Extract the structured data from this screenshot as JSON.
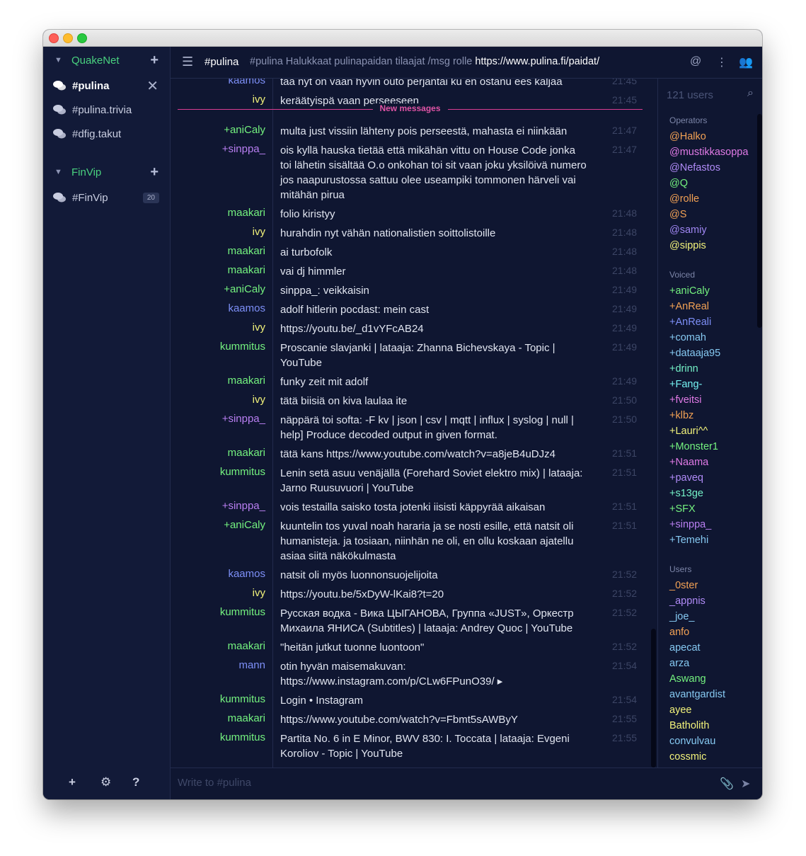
{
  "sidebar": {
    "networks": [
      {
        "name": "QuakeNet",
        "channels": [
          {
            "label": "#pulina",
            "active": true
          },
          {
            "label": "#pulina.trivia"
          },
          {
            "label": "#dfig.takut"
          }
        ]
      },
      {
        "name": "FinVip",
        "channels": [
          {
            "label": "#FinVip",
            "badge": "20"
          }
        ]
      }
    ]
  },
  "header": {
    "channel": "#pulina",
    "topic_text": "#pulina Halukkaat pulinapaidan tilaajat /msg rolle",
    "topic_link": "https://www.pulina.fi/paidat/"
  },
  "new_messages_label": "New messages",
  "messages": [
    {
      "nick": "kaamos",
      "color": "#7d8ff7",
      "time": "21:45",
      "lines": [
        "taa nyt on vaan hyvin outo perjantai ku en ostanu ees kaljaa"
      ]
    },
    {
      "nick": "ivy",
      "color": "#f2f27a",
      "time": "21:45",
      "lines": [
        "keräätyispä vaan perseeseen"
      ]
    },
    {
      "nick": "+aniCaly",
      "color": "#74f27f",
      "time": "21:47",
      "lines": [
        "multa just vissiin lähteny pois perseestä, mahasta ei niinkään"
      ]
    },
    {
      "nick": "+sinppa_",
      "color": "#b97ff2",
      "time": "21:47",
      "lines": [
        "ois kyllä hauska tietää että mikähän vittu on House Code jonka",
        "toi lähetin sisältää O.o onkohan toi sit vaan joku yksilöivä numero",
        "jos naapurustossa sattuu olee useampiki tommonen härveli vai",
        "mitähän pirua"
      ]
    },
    {
      "nick": "maakari",
      "color": "#74f27f",
      "time": "21:48",
      "lines": [
        "folio kiristyy"
      ]
    },
    {
      "nick": "ivy",
      "color": "#f2f27a",
      "time": "21:48",
      "lines": [
        "hurahdin nyt vähän nationalistien soittolistoille"
      ]
    },
    {
      "nick": "maakari",
      "color": "#74f27f",
      "time": "21:48",
      "lines": [
        "ai turbofolk"
      ]
    },
    {
      "nick": "maakari",
      "color": "#74f27f",
      "time": "21:48",
      "lines": [
        "vai dj himmler"
      ]
    },
    {
      "nick": "+aniCaly",
      "color": "#74f27f",
      "time": "21:49",
      "lines": [
        "sinppa_: veikkaisin"
      ]
    },
    {
      "nick": "kaamos",
      "color": "#7d8ff7",
      "time": "21:49",
      "lines": [
        "adolf hitlerin pocdast: mein cast"
      ]
    },
    {
      "nick": "ivy",
      "color": "#f2f27a",
      "time": "21:49",
      "lines": [
        "https://youtu.be/_d1vYFcAB24"
      ]
    },
    {
      "nick": "kummitus",
      "color": "#74f27f",
      "time": "21:49",
      "lines": [
        "Proscanie slavjanki | lataaja: Zhanna Bichevskaya - Topic |",
        "YouTube"
      ]
    },
    {
      "nick": "maakari",
      "color": "#74f27f",
      "time": "21:49",
      "lines": [
        "funky zeit mit adolf"
      ]
    },
    {
      "nick": "ivy",
      "color": "#f2f27a",
      "time": "21:50",
      "lines": [
        "tätä biisiä on kiva laulaa ite"
      ]
    },
    {
      "nick": "+sinppa_",
      "color": "#b97ff2",
      "time": "21:50",
      "lines": [
        "näppärä toi softa: -F kv | json | csv | mqtt | influx | syslog | null |",
        "help] Produce decoded output in given format."
      ]
    },
    {
      "nick": "maakari",
      "color": "#74f27f",
      "time": "21:51",
      "lines": [
        "tätä kans https://www.youtube.com/watch?v=a8jeB4uDJz4"
      ]
    },
    {
      "nick": "kummitus",
      "color": "#74f27f",
      "time": "21:51",
      "lines": [
        "Lenin setä asuu venäjällä (Forehard Soviet elektro mix) | lataaja:",
        "Jarno Ruusuvuori | YouTube"
      ]
    },
    {
      "nick": "+sinppa_",
      "color": "#b97ff2",
      "time": "21:51",
      "lines": [
        "vois testailla saisko tosta jotenki iisisti käppyrää aikaisan"
      ]
    },
    {
      "nick": "+aniCaly",
      "color": "#74f27f",
      "time": "21:51",
      "lines": [
        "kuuntelin tos yuval noah hararia ja se nosti esille, että natsit oli",
        "humanisteja. ja tosiaan, niinhän ne oli, en ollu koskaan ajatellu",
        "asiaa siitä näkökulmasta"
      ]
    },
    {
      "nick": "kaamos",
      "color": "#7d8ff7",
      "time": "21:52",
      "lines": [
        "natsit oli myös luonnonsuojelijoita"
      ]
    },
    {
      "nick": "ivy",
      "color": "#f2f27a",
      "time": "21:52",
      "lines": [
        "https://youtu.be/5xDyW-lKai8?t=20"
      ]
    },
    {
      "nick": "kummitus",
      "color": "#74f27f",
      "time": "21:52",
      "lines": [
        "Русская водка - Вика ЦЫГАНОВА, Группа «JUST», Оркестр",
        "Михаила ЯНИСА (Subtitles) | lataaja: Andrey Quoc | YouTube"
      ]
    },
    {
      "nick": "maakari",
      "color": "#74f27f",
      "time": "21:52",
      "lines": [
        "\"heitän jutkut tuonne luontoon\""
      ]
    },
    {
      "nick": "mann",
      "color": "#7d8ff7",
      "time": "21:54",
      "lines": [
        "otin hyvän maisemakuvan:",
        "https://www.instagram.com/p/CLw6FPunO39/ ▸"
      ]
    },
    {
      "nick": "kummitus",
      "color": "#74f27f",
      "time": "21:54",
      "lines": [
        "Login • Instagram"
      ]
    },
    {
      "nick": "maakari",
      "color": "#74f27f",
      "time": "21:55",
      "lines": [
        "https://www.youtube.com/watch?v=Fbmt5sAWByY"
      ]
    },
    {
      "nick": "kummitus",
      "color": "#74f27f",
      "time": "21:55",
      "lines": [
        "Partita No. 6 in E Minor, BWV 830: I. Toccata | lataaja: Evgeni",
        "Koroliov - Topic | YouTube"
      ]
    }
  ],
  "userlist": {
    "count": "121 users",
    "sections": [
      {
        "title": "Operators",
        "users": [
          {
            "name": "@Halko",
            "color": "#f2a154"
          },
          {
            "name": "@mustikkasoppa",
            "color": "#e07ae6"
          },
          {
            "name": "@Nefastos",
            "color": "#b08bf7"
          },
          {
            "name": "@Q",
            "color": "#74f27f"
          },
          {
            "name": "@rolle",
            "color": "#f2a154"
          },
          {
            "name": "@S",
            "color": "#f2a154"
          },
          {
            "name": "@samiy",
            "color": "#9f86f2"
          },
          {
            "name": "@sippis",
            "color": "#f2f27a"
          }
        ]
      },
      {
        "title": "Voiced",
        "users": [
          {
            "name": "+aniCaly",
            "color": "#74f27f"
          },
          {
            "name": "+AnReal",
            "color": "#f2a154"
          },
          {
            "name": "+AnReali",
            "color": "#7d8ff7"
          },
          {
            "name": "+comah",
            "color": "#86c9f2"
          },
          {
            "name": "+dataaja95",
            "color": "#86c9f2"
          },
          {
            "name": "+drinn",
            "color": "#74f2c8"
          },
          {
            "name": "+Fang-",
            "color": "#74f2f2"
          },
          {
            "name": "+fveitsi",
            "color": "#e07ae6"
          },
          {
            "name": "+klbz",
            "color": "#f2a154"
          },
          {
            "name": "+Lauri^^",
            "color": "#f2f27a"
          },
          {
            "name": "+Monster1",
            "color": "#74f27f"
          },
          {
            "name": "+Naama",
            "color": "#e07ae6"
          },
          {
            "name": "+paveq",
            "color": "#b08bf7"
          },
          {
            "name": "+s13ge",
            "color": "#74f2c8"
          },
          {
            "name": "+SFX",
            "color": "#74f27f"
          },
          {
            "name": "+sinppa_",
            "color": "#b97ff2"
          },
          {
            "name": "+Temehi",
            "color": "#86c9f2"
          }
        ]
      },
      {
        "title": "Users",
        "users": [
          {
            "name": "_0ster",
            "color": "#f2a154"
          },
          {
            "name": "_appnis",
            "color": "#b08bf7"
          },
          {
            "name": "_joe_",
            "color": "#86c9f2"
          },
          {
            "name": "anfo",
            "color": "#f2a154"
          },
          {
            "name": "apecat",
            "color": "#86c9f2"
          },
          {
            "name": "arza",
            "color": "#86c9f2"
          },
          {
            "name": "Aswang",
            "color": "#74f27f"
          },
          {
            "name": "avantgardist",
            "color": "#86c9f2"
          },
          {
            "name": "ayee",
            "color": "#f2f27a"
          },
          {
            "name": "Batholith",
            "color": "#f2f27a"
          },
          {
            "name": "convulvau",
            "color": "#86c9f2"
          },
          {
            "name": "cossmic",
            "color": "#f2f27a"
          }
        ]
      }
    ]
  },
  "composer": {
    "placeholder": "Write to #pulina"
  }
}
